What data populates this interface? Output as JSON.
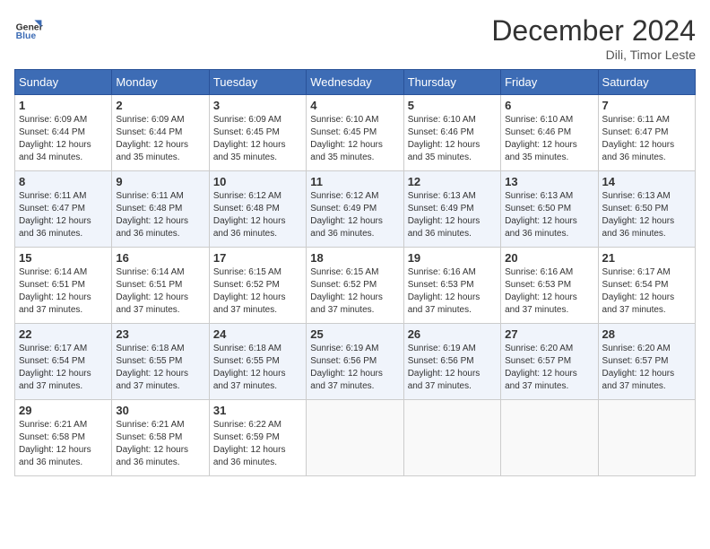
{
  "header": {
    "logo_line1": "General",
    "logo_line2": "Blue",
    "month_title": "December 2024",
    "subtitle": "Dili, Timor Leste"
  },
  "days_of_week": [
    "Sunday",
    "Monday",
    "Tuesday",
    "Wednesday",
    "Thursday",
    "Friday",
    "Saturday"
  ],
  "weeks": [
    [
      {
        "day": "1",
        "sunrise": "6:09 AM",
        "sunset": "6:44 PM",
        "daylight": "12 hours and 34 minutes."
      },
      {
        "day": "2",
        "sunrise": "6:09 AM",
        "sunset": "6:44 PM",
        "daylight": "12 hours and 35 minutes."
      },
      {
        "day": "3",
        "sunrise": "6:09 AM",
        "sunset": "6:45 PM",
        "daylight": "12 hours and 35 minutes."
      },
      {
        "day": "4",
        "sunrise": "6:10 AM",
        "sunset": "6:45 PM",
        "daylight": "12 hours and 35 minutes."
      },
      {
        "day": "5",
        "sunrise": "6:10 AM",
        "sunset": "6:46 PM",
        "daylight": "12 hours and 35 minutes."
      },
      {
        "day": "6",
        "sunrise": "6:10 AM",
        "sunset": "6:46 PM",
        "daylight": "12 hours and 35 minutes."
      },
      {
        "day": "7",
        "sunrise": "6:11 AM",
        "sunset": "6:47 PM",
        "daylight": "12 hours and 36 minutes."
      }
    ],
    [
      {
        "day": "8",
        "sunrise": "6:11 AM",
        "sunset": "6:47 PM",
        "daylight": "12 hours and 36 minutes."
      },
      {
        "day": "9",
        "sunrise": "6:11 AM",
        "sunset": "6:48 PM",
        "daylight": "12 hours and 36 minutes."
      },
      {
        "day": "10",
        "sunrise": "6:12 AM",
        "sunset": "6:48 PM",
        "daylight": "12 hours and 36 minutes."
      },
      {
        "day": "11",
        "sunrise": "6:12 AM",
        "sunset": "6:49 PM",
        "daylight": "12 hours and 36 minutes."
      },
      {
        "day": "12",
        "sunrise": "6:13 AM",
        "sunset": "6:49 PM",
        "daylight": "12 hours and 36 minutes."
      },
      {
        "day": "13",
        "sunrise": "6:13 AM",
        "sunset": "6:50 PM",
        "daylight": "12 hours and 36 minutes."
      },
      {
        "day": "14",
        "sunrise": "6:13 AM",
        "sunset": "6:50 PM",
        "daylight": "12 hours and 36 minutes."
      }
    ],
    [
      {
        "day": "15",
        "sunrise": "6:14 AM",
        "sunset": "6:51 PM",
        "daylight": "12 hours and 37 minutes."
      },
      {
        "day": "16",
        "sunrise": "6:14 AM",
        "sunset": "6:51 PM",
        "daylight": "12 hours and 37 minutes."
      },
      {
        "day": "17",
        "sunrise": "6:15 AM",
        "sunset": "6:52 PM",
        "daylight": "12 hours and 37 minutes."
      },
      {
        "day": "18",
        "sunrise": "6:15 AM",
        "sunset": "6:52 PM",
        "daylight": "12 hours and 37 minutes."
      },
      {
        "day": "19",
        "sunrise": "6:16 AM",
        "sunset": "6:53 PM",
        "daylight": "12 hours and 37 minutes."
      },
      {
        "day": "20",
        "sunrise": "6:16 AM",
        "sunset": "6:53 PM",
        "daylight": "12 hours and 37 minutes."
      },
      {
        "day": "21",
        "sunrise": "6:17 AM",
        "sunset": "6:54 PM",
        "daylight": "12 hours and 37 minutes."
      }
    ],
    [
      {
        "day": "22",
        "sunrise": "6:17 AM",
        "sunset": "6:54 PM",
        "daylight": "12 hours and 37 minutes."
      },
      {
        "day": "23",
        "sunrise": "6:18 AM",
        "sunset": "6:55 PM",
        "daylight": "12 hours and 37 minutes."
      },
      {
        "day": "24",
        "sunrise": "6:18 AM",
        "sunset": "6:55 PM",
        "daylight": "12 hours and 37 minutes."
      },
      {
        "day": "25",
        "sunrise": "6:19 AM",
        "sunset": "6:56 PM",
        "daylight": "12 hours and 37 minutes."
      },
      {
        "day": "26",
        "sunrise": "6:19 AM",
        "sunset": "6:56 PM",
        "daylight": "12 hours and 37 minutes."
      },
      {
        "day": "27",
        "sunrise": "6:20 AM",
        "sunset": "6:57 PM",
        "daylight": "12 hours and 37 minutes."
      },
      {
        "day": "28",
        "sunrise": "6:20 AM",
        "sunset": "6:57 PM",
        "daylight": "12 hours and 37 minutes."
      }
    ],
    [
      {
        "day": "29",
        "sunrise": "6:21 AM",
        "sunset": "6:58 PM",
        "daylight": "12 hours and 36 minutes."
      },
      {
        "day": "30",
        "sunrise": "6:21 AM",
        "sunset": "6:58 PM",
        "daylight": "12 hours and 36 minutes."
      },
      {
        "day": "31",
        "sunrise": "6:22 AM",
        "sunset": "6:59 PM",
        "daylight": "12 hours and 36 minutes."
      },
      null,
      null,
      null,
      null
    ]
  ],
  "labels": {
    "sunrise_prefix": "Sunrise: ",
    "sunset_prefix": "Sunset: ",
    "daylight_prefix": "Daylight: "
  }
}
